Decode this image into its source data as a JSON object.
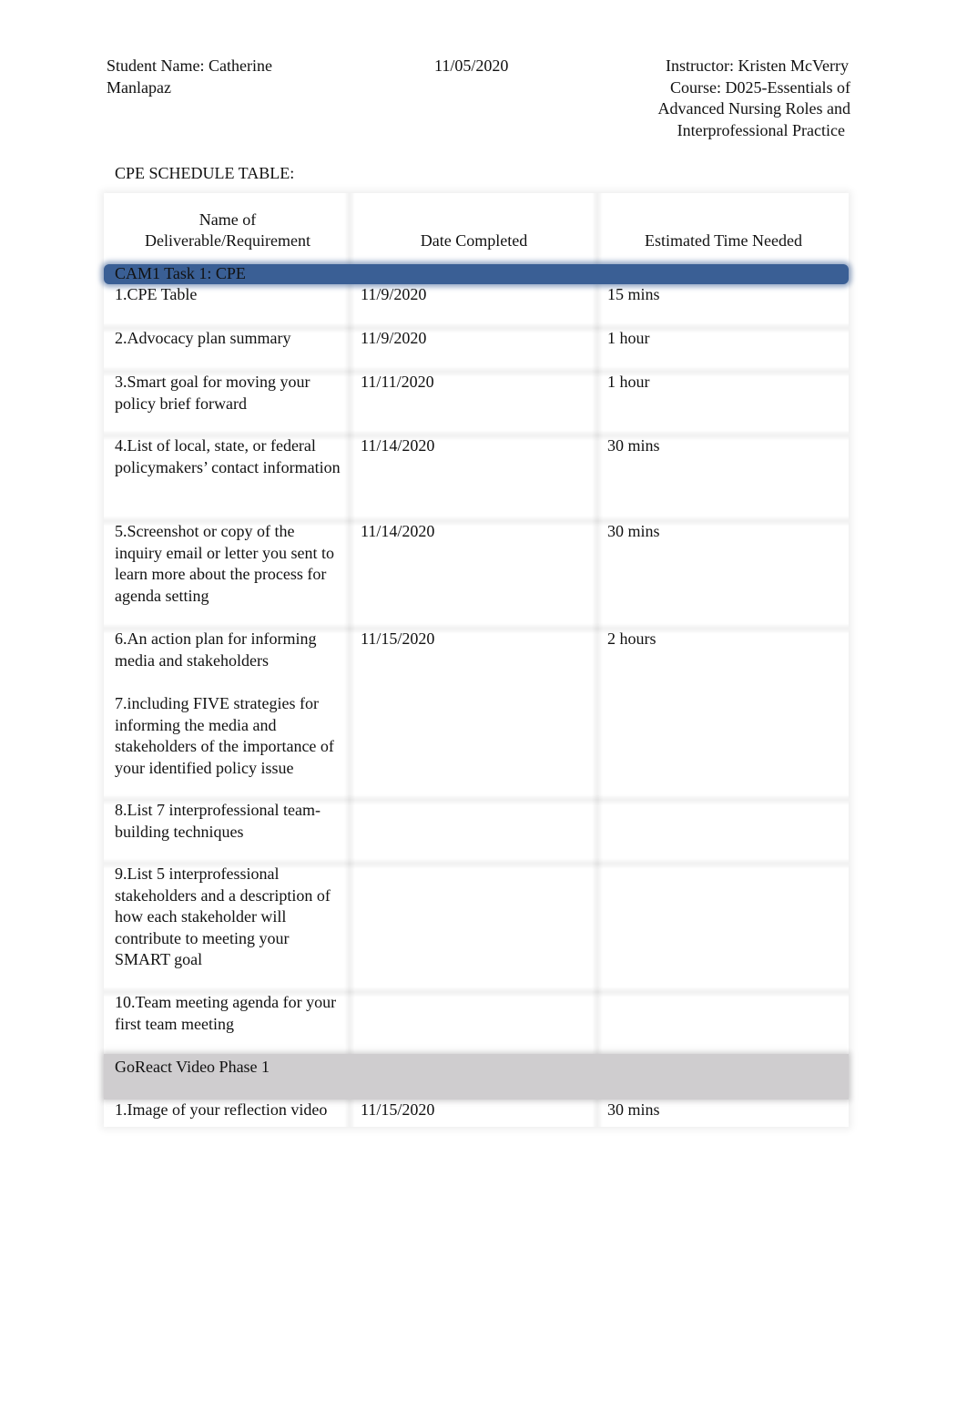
{
  "header": {
    "student_line1": "Student Name: Catherine",
    "student_line2": "Manlapaz",
    "date": "11/05/2020",
    "instructor": "Instructor: Kristen McVerry",
    "course_line1": "Course: D025-Essentials of",
    "course_line2": "Advanced Nursing Roles and",
    "course_line3": "Interprofessional Practice"
  },
  "table_title": "CPE SCHEDULE TABLE:",
  "table": {
    "columns": {
      "name_line1": "Name of",
      "name_line2": "Deliverable/Requirement",
      "date": "Date Completed",
      "time": "Estimated Time Needed"
    },
    "section1": {
      "title": "CAM1 Task 1: CPE",
      "color": "#3a5f95",
      "rows": [
        {
          "name": "1.CPE Table",
          "date": "11/9/2020",
          "time": "15 mins"
        },
        {
          "name": "2.Advocacy plan summary",
          "date": "11/9/2020",
          "time": "1 hour"
        },
        {
          "name": "3.Smart goal for moving your policy brief forward",
          "date": "11/11/2020",
          "time": "1 hour"
        },
        {
          "name": "4.List of local, state, or federal policymakers’ contact information",
          "date": "11/14/2020",
          "time": "30 mins"
        },
        {
          "name": "5.Screenshot or copy of the inquiry email or letter you sent to learn more about the process for agenda setting",
          "date": "11/14/2020",
          "time": "30 mins"
        },
        {
          "name": "6.An action plan for informing media and stakeholders",
          "name_extra": "7.including FIVE strategies for informing the media and stakeholders of the importance of your identified policy issue",
          "date": "11/15/2020",
          "time": "2 hours"
        },
        {
          "name": "8.List 7 interprofessional team-building techniques",
          "date": "",
          "time": ""
        },
        {
          "name": "9.List 5 interprofessional stakeholders and a description of how each stakeholder will contribute to meeting your SMART goal",
          "date": "",
          "time": ""
        },
        {
          "name": "10.Team meeting agenda for your first team meeting",
          "date": "",
          "time": ""
        }
      ]
    },
    "section2": {
      "title": "GoReact Video Phase 1",
      "color": "#cfcdcf",
      "rows": [
        {
          "name": "1.Image of your reflection video",
          "date": "11/15/2020",
          "time": "30 mins"
        }
      ]
    }
  }
}
